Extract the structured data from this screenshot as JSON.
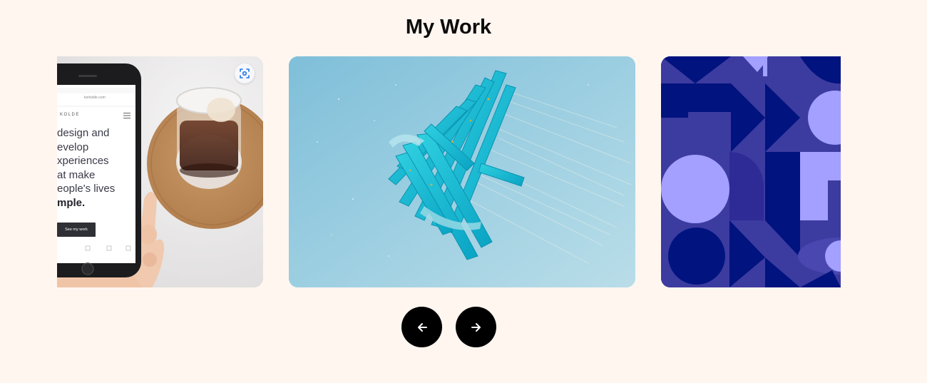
{
  "section": {
    "title": "My Work"
  },
  "slides": [
    {
      "name": "phone-mockup",
      "phone": {
        "url": "korkolde.com",
        "brand": "KOLDE",
        "lines": [
          "design and",
          "evelop",
          "xperiences",
          "at make",
          "eople's lives"
        ],
        "strong_line": "mple.",
        "cta": "See my work"
      },
      "lens_icon": "lens-search-icon"
    },
    {
      "name": "blue-sculpture"
    },
    {
      "name": "geometric-pattern"
    }
  ],
  "controls": {
    "prev_icon": "arrow-left-icon",
    "next_icon": "arrow-right-icon"
  },
  "colors": {
    "background": "#fff6f0",
    "button": "#000000",
    "pattern_dark": "#00137e",
    "pattern_mid": "#3c3ba0",
    "pattern_light": "#a3a0ff"
  }
}
